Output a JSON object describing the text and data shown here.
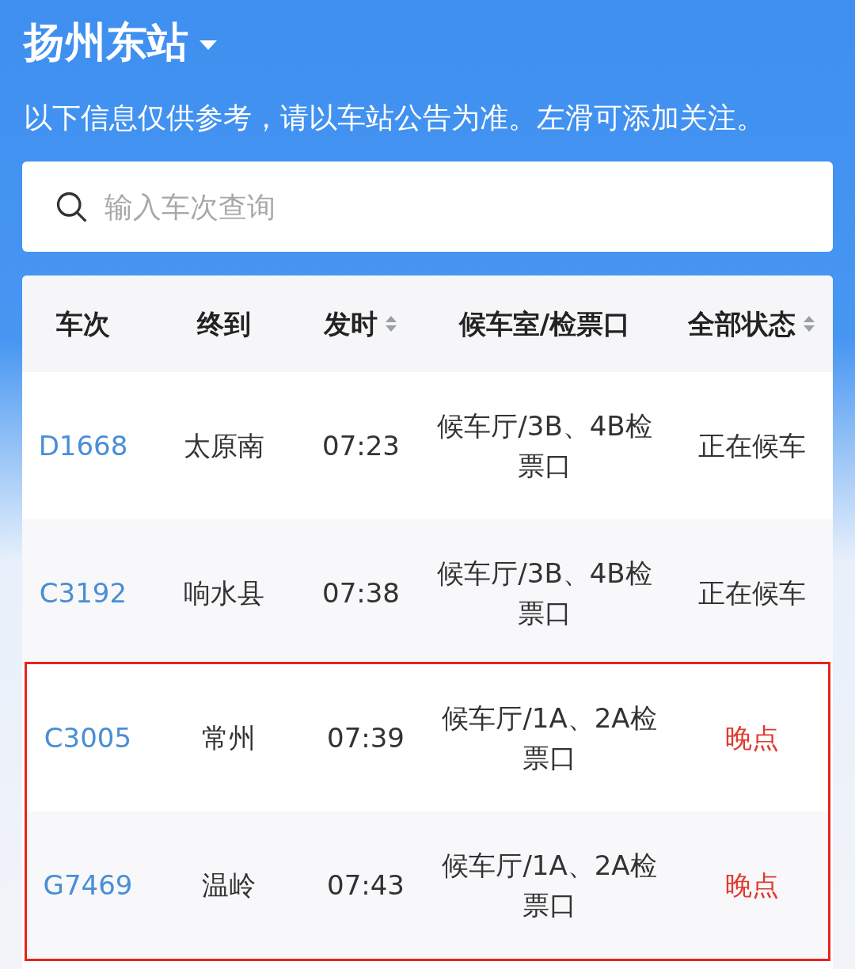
{
  "station": {
    "name": "扬州东站"
  },
  "notice": "以下信息仅供参考，请以车站公告为准。左滑可添加关注。",
  "search": {
    "placeholder": "输入车次查询"
  },
  "table": {
    "columns": [
      {
        "label": "车次"
      },
      {
        "label": "终到"
      },
      {
        "label": "发时",
        "sortable": true
      },
      {
        "label": "候车室/检票口"
      },
      {
        "label": "全部状态",
        "sortable": true
      }
    ],
    "rows": [
      {
        "train": "D1668",
        "destination": "太原南",
        "departure": "07:23",
        "gate": "候车厅/3B、4B检票口",
        "status": "正在候车",
        "late": false,
        "highlighted": false
      },
      {
        "train": "C3192",
        "destination": "响水县",
        "departure": "07:38",
        "gate": "候车厅/3B、4B检票口",
        "status": "正在候车",
        "late": false,
        "highlighted": false
      },
      {
        "train": "C3005",
        "destination": "常州",
        "departure": "07:39",
        "gate": "候车厅/1A、2A检票口",
        "status": "晚点",
        "late": true,
        "highlighted": true
      },
      {
        "train": "G7469",
        "destination": "温岭",
        "departure": "07:43",
        "gate": "候车厅/1A、2A检票口",
        "status": "晚点",
        "late": true,
        "highlighted": true
      }
    ]
  }
}
